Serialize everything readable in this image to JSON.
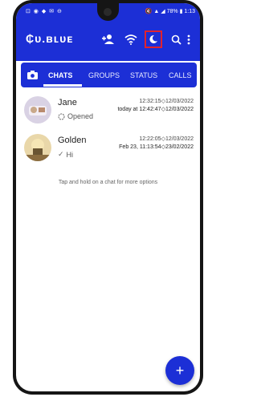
{
  "status_bar": {
    "left": "⊡ ◉ ◆ ✉ ⊖",
    "right": "🔇 ▲ ◢ 78% ▮ 1:13"
  },
  "toolbar": {
    "title": "₵ᴜ.ʙʟᴜᴇ",
    "icons": [
      "add-contact-icon",
      "wifi-icon",
      "night-mode-icon",
      "search-icon",
      "more-icon"
    ],
    "accent": "#1c2fd6",
    "highlight": "#e0232f"
  },
  "tabs": [
    "CHATS",
    "GROUPS",
    "STATUS",
    "CALLS"
  ],
  "active_tab": "CHATS",
  "chats": [
    {
      "name": "Jane",
      "status": "Opened",
      "time1": "12:32:15◇12/03/2022",
      "time2": "today at 12:42:47◇12/03/2022"
    },
    {
      "name": "Golden",
      "status": "Hi",
      "time1": "12:22:05◇12/03/2022",
      "time2": "Feb 23, 11:13:54◇23/02/2022"
    }
  ],
  "hint": "Tap and hold on a chat for more options",
  "fab_label": "+"
}
